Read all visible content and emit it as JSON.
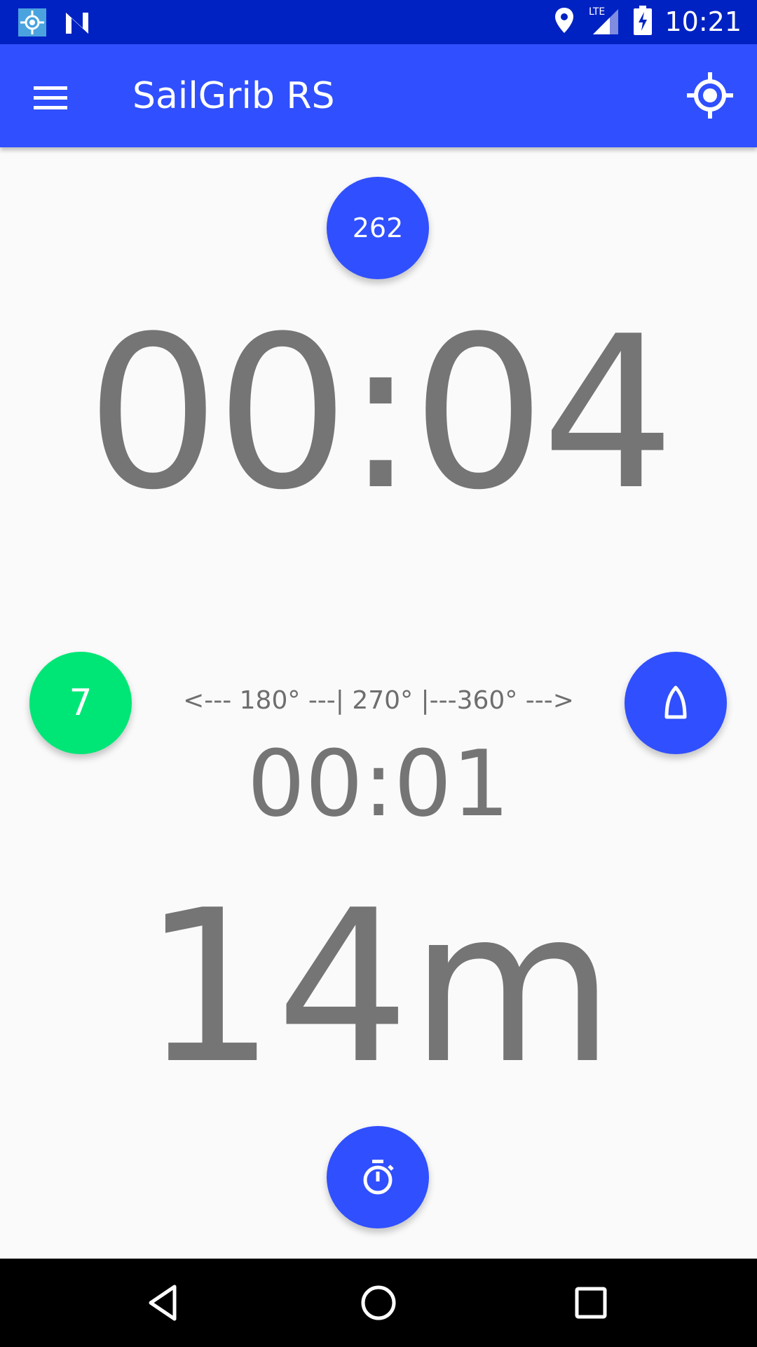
{
  "status_bar": {
    "time": "10:21",
    "network": "LTE",
    "icons": [
      "gps-status-icon",
      "n-notification-icon",
      "location-icon",
      "signal-icon",
      "battery-charging-icon"
    ]
  },
  "app_bar": {
    "title": "SailGrib RS",
    "menu_icon": "menu-icon",
    "action_icon": "gps-fixed-icon",
    "background": "#304ffe"
  },
  "main": {
    "heading_value": "262",
    "countdown": "00:04",
    "count_value": "7",
    "angle_scale": "<--- 180° ---| 270° |---360° --->",
    "sub_time": "00:01",
    "distance": "14m"
  },
  "colors": {
    "accent": "#304ffe",
    "status_bar": "#0022c2",
    "green": "#00e676",
    "text_gray": "#757575"
  }
}
